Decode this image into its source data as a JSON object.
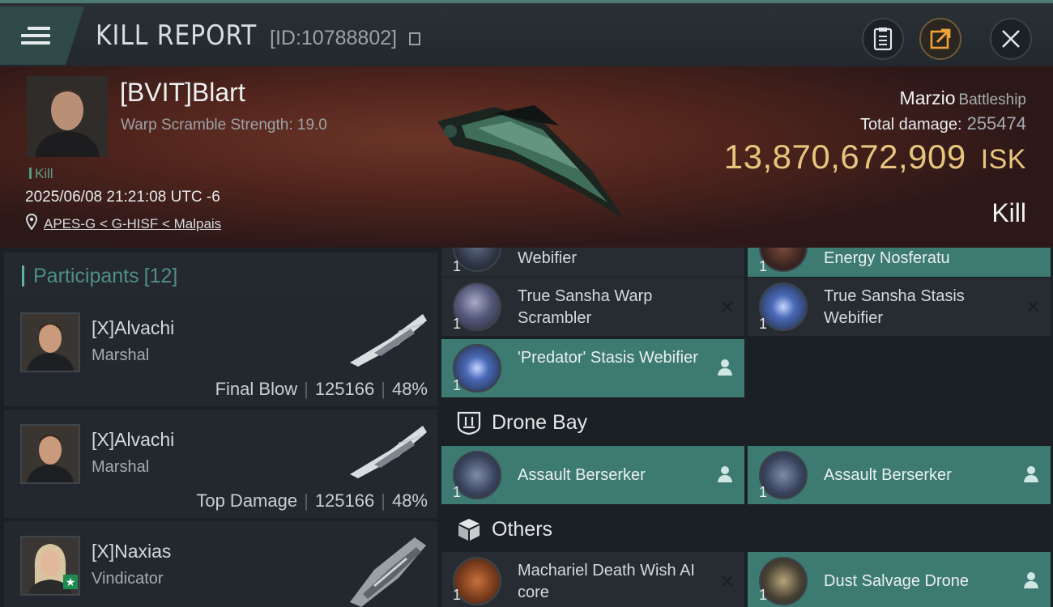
{
  "header": {
    "title": "KILL REPORT",
    "report_id": "[ID:10788802]"
  },
  "victim": {
    "pilot": "[BVIT]Blart",
    "subtitle": "Warp Scramble Strength: 19.0",
    "kill_tag": "Kill",
    "datetime": "2025/06/08 21:21:08 UTC -6",
    "location": "APES-G < G-HISF < Malpais",
    "ship": "Marzio",
    "ship_class": "Battleship",
    "total_damage_label": "Total damage:",
    "total_damage": "255474",
    "isk_value": "13,870,672,909",
    "isk_unit": "ISK",
    "result": "Kill"
  },
  "participants": {
    "label": "Participants",
    "count": "[12]",
    "rows": [
      {
        "name": "[X]Alvachi",
        "ship": "Marshal",
        "role": "Final Blow",
        "damage": "125166",
        "percent": "48%"
      },
      {
        "name": "[X]Alvachi",
        "ship": "Marshal",
        "role": "Top Damage",
        "damage": "125166",
        "percent": "48%"
      },
      {
        "name": "[X]Naxias",
        "ship": "Vindicator"
      }
    ]
  },
  "fitting": {
    "top_partial": [
      {
        "qty": "1",
        "name": "Webifier"
      },
      {
        "qty": "1",
        "name": "Energy Nosferatu"
      }
    ],
    "mid_slots": [
      {
        "qty": "1",
        "name": "True Sansha Warp Scrambler",
        "state": "destroyed"
      },
      {
        "qty": "1",
        "name": "True Sansha Stasis Webifier",
        "state": "destroyed"
      },
      {
        "qty": "1",
        "name": "'Predator' Stasis Webifier",
        "state": "dropped"
      }
    ],
    "drone_bay_label": "Drone Bay",
    "drones": [
      {
        "qty": "1",
        "name": "Assault Berserker",
        "state": "dropped"
      },
      {
        "qty": "1",
        "name": "Assault Berserker",
        "state": "dropped"
      }
    ],
    "others_label": "Others",
    "others": [
      {
        "qty": "1",
        "name": "Machariel Death Wish AI core",
        "state": "destroyed"
      },
      {
        "qty": "1",
        "name": "Dust Salvage Drone",
        "state": "dropped"
      }
    ]
  },
  "icons": {
    "menu": "hamburger-icon",
    "notes": "clipboard-icon",
    "share": "share-icon",
    "close": "close-icon",
    "location": "map-pin-icon",
    "destroyed": "x-mark-icon",
    "dropped": "person-icon",
    "drone_bay": "drone-bay-icon",
    "others": "cube-icon"
  },
  "colors": {
    "accent": "#3d7a72",
    "isk": "#e8c57d",
    "header_border": "#4d7a72"
  }
}
